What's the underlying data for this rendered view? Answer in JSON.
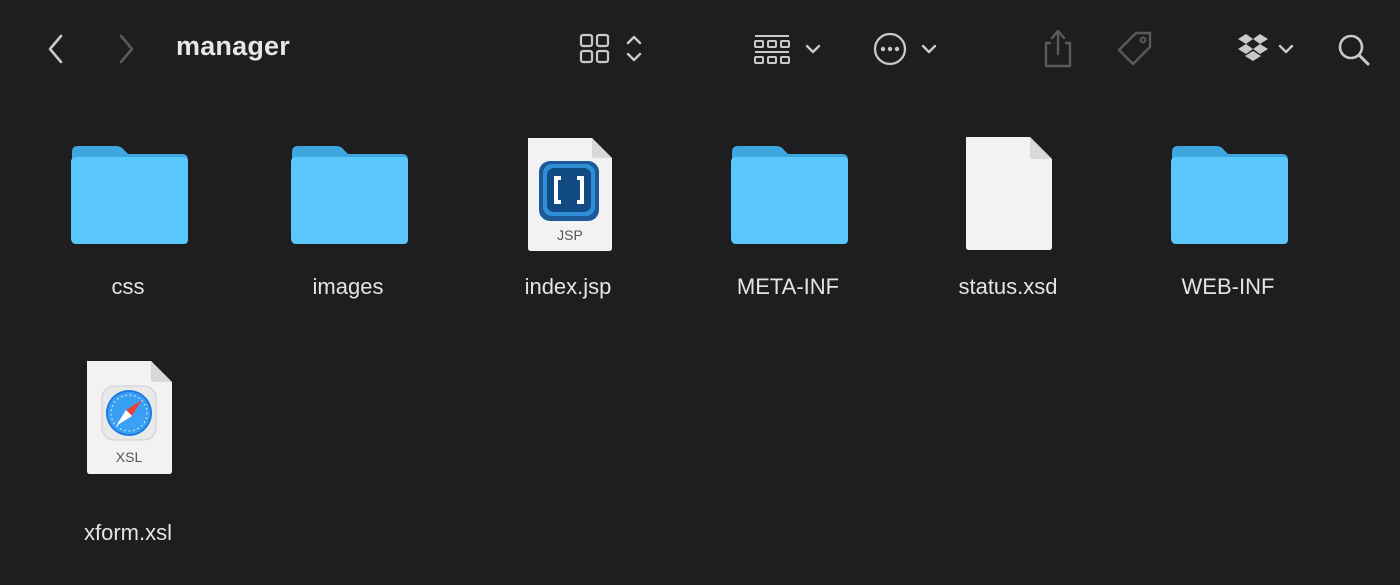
{
  "window": {
    "title": "manager"
  },
  "toolbar": {
    "back_icon": "chevron-left-icon",
    "forward_icon": "chevron-right-icon",
    "view_icon": "icon-grid-icon",
    "group_icon": "group-by-icon",
    "action_icon": "ellipsis-circle-icon",
    "share_icon": "share-icon",
    "tag_icon": "tag-icon",
    "dropbox_icon": "dropbox-icon",
    "search_icon": "search-icon"
  },
  "colors": {
    "background": "#1e1e20",
    "folder_front": "#5ac8fa",
    "folder_back": "#3ea7e0",
    "text": "#e4e4e4",
    "toolbar_icon": "#c9c9c9",
    "toolbar_icon_disabled": "#5a5a5c"
  },
  "items": [
    {
      "name": "css",
      "kind": "folder"
    },
    {
      "name": "images",
      "kind": "folder"
    },
    {
      "name": "index.jsp",
      "kind": "jsp-file",
      "badge": "JSP"
    },
    {
      "name": "META-INF",
      "kind": "folder"
    },
    {
      "name": "status.xsd",
      "kind": "blank-file"
    },
    {
      "name": "WEB-INF",
      "kind": "folder"
    },
    {
      "name": "xform.xsl",
      "kind": "xsl-file",
      "badge": "XSL"
    }
  ]
}
